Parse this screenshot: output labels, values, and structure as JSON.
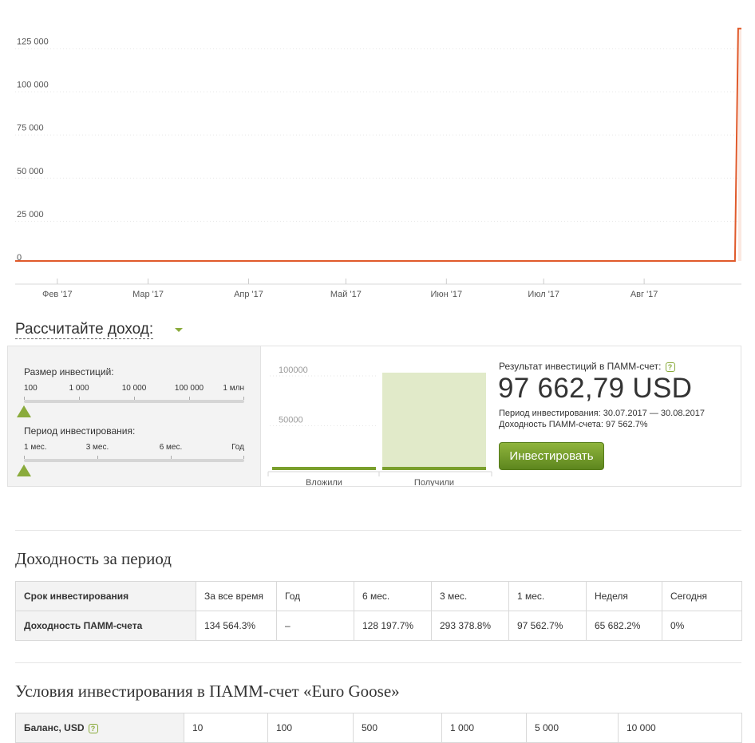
{
  "chart_data": {
    "type": "line",
    "y_ticks": [
      "125 000",
      "100 000",
      "75 000",
      "50 000",
      "25 000",
      "0"
    ],
    "x_ticks": [
      "Фев '17",
      "Мар '17",
      "Апр '17",
      "Май '17",
      "Июн '17",
      "Июл '17",
      "Авг '17"
    ],
    "ylim": [
      0,
      135000
    ],
    "xlim": [
      "2017-01-19",
      "2017-08-31"
    ],
    "grid": true,
    "line_color": "#e05a2b",
    "series": [
      {
        "points": [
          {
            "x": "2017-01-19",
            "y": 0
          },
          {
            "x": "2017-04-01",
            "y": 0
          },
          {
            "x": "2017-05-01",
            "y": 0
          },
          {
            "x": "2017-06-01",
            "y": 0
          },
          {
            "x": "2017-07-01",
            "y": 0
          },
          {
            "x": "2017-08-01",
            "y": 0
          },
          {
            "x": "2017-08-29",
            "y": 0
          },
          {
            "x": "2017-08-30",
            "y": 134564
          }
        ]
      }
    ]
  },
  "calculator": {
    "title": "Рассчитайте доход:",
    "investment_size_label": "Размер инвестиций:",
    "investment_ticks": [
      "100",
      "1 000",
      "10 000",
      "100 000",
      "1 млн"
    ],
    "investment_selected_fraction": 0,
    "period_label": "Период инвестирования:",
    "period_ticks": [
      "1 мес.",
      "3 мес.",
      "6 мес.",
      "Год"
    ],
    "period_selected_fraction": 0,
    "bar_chart": {
      "type": "bar",
      "categories": [
        "Вложили",
        "Получили"
      ],
      "values": [
        100,
        97662.79
      ],
      "grid_labels": [
        "100000",
        "50000"
      ],
      "ylim": [
        0,
        110000
      ],
      "fill_color": "#e1eac9",
      "accent_color": "#7a9f2c"
    },
    "result_label": "Результат инвестиций в ПАММ-счет:",
    "result_value": "97 662,79 USD",
    "period_text": "Период инвестирования: 30.07.2017 — 30.08.2017",
    "yield_text": "Доходность ПАММ-счета: 97 562.7%",
    "invest_button": "Инвестировать",
    "help_icon": "?"
  },
  "returns": {
    "title": "Доходность за период",
    "row_labels": [
      "Срок инвестирования",
      "Доходность ПАММ-счета"
    ],
    "periods": [
      "За все время",
      "Год",
      "6 мес.",
      "3 мес.",
      "1 мес.",
      "Неделя",
      "Сегодня"
    ],
    "values": [
      "134 564.3%",
      "–",
      "128 197.7%",
      "293 378.8%",
      "97 562.7%",
      "65 682.2%",
      "0%"
    ]
  },
  "conditions": {
    "title": "Условия инвестирования в ПАММ-счет «Euro Goose»",
    "balance_label": "Баланс, USD",
    "help_icon": "?",
    "balances": [
      "10",
      "100",
      "500",
      "1 000",
      "5 000",
      "10 000"
    ]
  }
}
